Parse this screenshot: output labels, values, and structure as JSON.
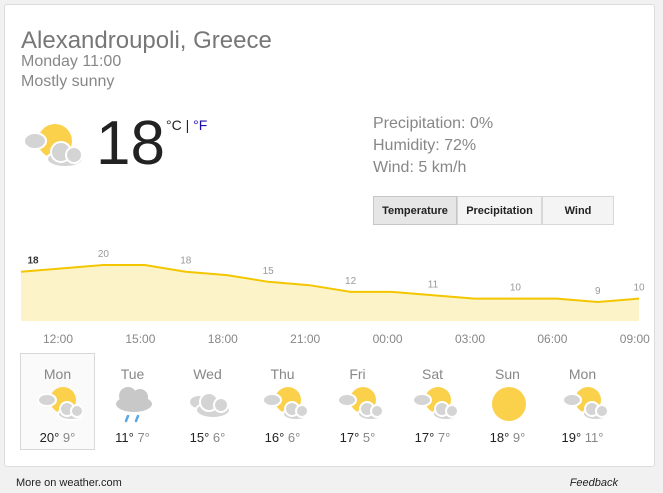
{
  "location": "Alexandroupoli, Greece",
  "datetime": "Monday 11:00",
  "condition": "Mostly sunny",
  "current": {
    "temperature": "18",
    "unit_c": "°C",
    "separator": "|",
    "unit_f": "°F",
    "icon": "partly-sunny-icon"
  },
  "details": {
    "precipitation": "Precipitation: 0%",
    "humidity": "Humidity: 72%",
    "wind": "Wind: 5 km/h"
  },
  "tabs": [
    {
      "label": "Temperature",
      "active": true
    },
    {
      "label": "Precipitation",
      "active": false
    },
    {
      "label": "Wind",
      "active": false
    }
  ],
  "colors": {
    "chart_line": "#f3c600",
    "chart_fill": "#fdf3c8",
    "sun": "#fbd14b",
    "cloud": "#d4d4d4"
  },
  "chart_data": {
    "type": "area",
    "x": [
      "12:00",
      "13:30",
      "15:00",
      "16:30",
      "18:00",
      "19:30",
      "21:00",
      "22:30",
      "00:00",
      "01:30",
      "03:00",
      "04:30",
      "06:00",
      "07:30",
      "09:00",
      "10:30"
    ],
    "values": [
      18,
      19,
      20,
      20,
      18,
      17,
      15,
      14,
      12,
      12,
      11,
      10,
      10,
      10,
      9,
      10
    ],
    "point_labels": [
      {
        "x": "12:00",
        "label": "18"
      },
      {
        "x": "15:00",
        "label": "20"
      },
      {
        "x": "18:00",
        "label": "18"
      },
      {
        "x": "21:00",
        "label": "15"
      },
      {
        "x": "00:00",
        "label": "12"
      },
      {
        "x": "03:00",
        "label": "11"
      },
      {
        "x": "06:00",
        "label": "10"
      },
      {
        "x": "09:00",
        "label": "9"
      },
      {
        "x": "10:30",
        "label": "10"
      }
    ],
    "tick_labels": [
      "12:00",
      "15:00",
      "18:00",
      "21:00",
      "00:00",
      "03:00",
      "06:00",
      "09:00"
    ],
    "ylim": [
      0,
      22
    ]
  },
  "days": [
    {
      "name": "Mon",
      "hi": "20°",
      "lo": "9°",
      "icon": "partly-sunny-icon",
      "selected": true
    },
    {
      "name": "Tue",
      "hi": "11°",
      "lo": "7°",
      "icon": "rain-icon",
      "selected": false
    },
    {
      "name": "Wed",
      "hi": "15°",
      "lo": "6°",
      "icon": "cloud-icon",
      "selected": false
    },
    {
      "name": "Thu",
      "hi": "16°",
      "lo": "6°",
      "icon": "partly-sunny-icon",
      "selected": false
    },
    {
      "name": "Fri",
      "hi": "17°",
      "lo": "5°",
      "icon": "partly-sunny-icon",
      "selected": false
    },
    {
      "name": "Sat",
      "hi": "17°",
      "lo": "7°",
      "icon": "partly-sunny-icon",
      "selected": false
    },
    {
      "name": "Sun",
      "hi": "18°",
      "lo": "9°",
      "icon": "sun-icon",
      "selected": false
    },
    {
      "name": "Mon",
      "hi": "19°",
      "lo": "11°",
      "icon": "partly-sunny-icon",
      "selected": false
    }
  ],
  "footer": {
    "source": "More on weather.com",
    "feedback": "Feedback"
  }
}
